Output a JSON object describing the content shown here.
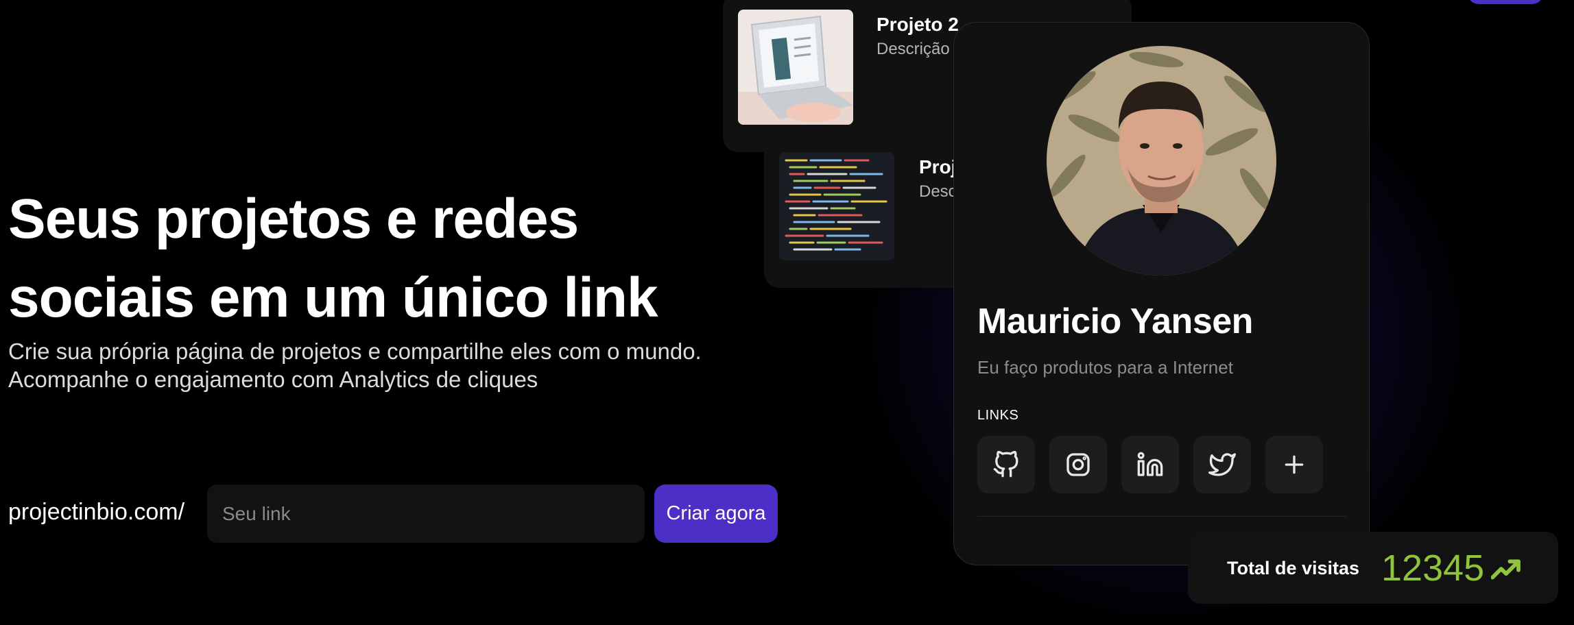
{
  "hero": {
    "title": "Seus projetos e redes sociais em um único link",
    "subtitle_line1": "Crie sua própria página de projetos e compartilhe eles com o mundo.",
    "subtitle_line2": "Acompanhe o engajamento com Analytics de cliques"
  },
  "link_form": {
    "prefix": "projectinbio.com/",
    "placeholder": "Seu link",
    "submit_label": "Criar agora"
  },
  "projects": [
    {
      "title": "Projeto 2",
      "description": "Descrição"
    },
    {
      "title": "Proj",
      "description": "Desc"
    }
  ],
  "profile": {
    "name": "Mauricio Yansen",
    "bio": "Eu faço produtos para a Internet",
    "links_label": "LINKS",
    "social_icons": [
      "github-icon",
      "instagram-icon",
      "linkedin-icon",
      "twitter-icon",
      "plus-icon"
    ]
  },
  "visits": {
    "label": "Total de visitas",
    "value": "12345"
  },
  "colors": {
    "accent": "#4c2fc6",
    "success": "#8fc43c",
    "background": "#000000",
    "card": "#111111"
  }
}
